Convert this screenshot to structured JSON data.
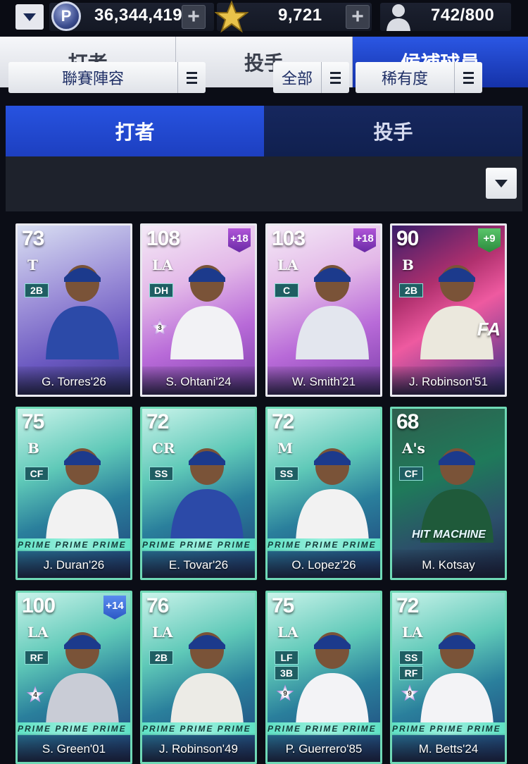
{
  "topbar": {
    "points_icon": "P",
    "points": "36,344,419",
    "stars": "9,721",
    "roster": "742/800"
  },
  "main_tabs": [
    "打者",
    "投手",
    "候補球員"
  ],
  "sub_tabs": [
    "打者",
    "投手"
  ],
  "filters": {
    "lineup": "聯賽陣容",
    "scope": "全部",
    "sort": "稀有度"
  },
  "cards": [
    {
      "ovr": "73",
      "team": "T",
      "pos": [
        "2B"
      ],
      "name": "G. Torres'26",
      "style": "wbc",
      "player_color": "#2c4aa8"
    },
    {
      "ovr": "108",
      "team": "LA",
      "pos": [
        "DH"
      ],
      "name": "S. Ohtani'24",
      "style": "signature",
      "bonus": "+18",
      "badge": "3",
      "player_color": "#f2f2f5"
    },
    {
      "ovr": "103",
      "team": "LA",
      "pos": [
        "C"
      ],
      "name": "W. Smith'21",
      "style": "signature",
      "bonus": "+18",
      "player_color": "#e3e6ee"
    },
    {
      "ovr": "90",
      "team": "B",
      "pos": [
        "2B"
      ],
      "name": "J. Robinson'51",
      "style": "fa",
      "bonus": "+9",
      "overlay": "FA",
      "player_color": "#ebe8dd"
    },
    {
      "ovr": "75",
      "team": "B",
      "pos": [
        "CF"
      ],
      "name": "J. Duran'26",
      "style": "prime",
      "player_color": "#f2f2f2"
    },
    {
      "ovr": "72",
      "team": "CR",
      "pos": [
        "SS"
      ],
      "name": "E. Tovar'26",
      "style": "prime",
      "player_color": "#2c4aa8"
    },
    {
      "ovr": "72",
      "team": "M",
      "pos": [
        "SS"
      ],
      "name": "O. Lopez'26",
      "style": "prime",
      "player_color": "#f2f2f2"
    },
    {
      "ovr": "68",
      "team": "A's",
      "pos": [
        "CF"
      ],
      "name": "M. Kotsay",
      "style": "hitmachine",
      "overlay": "HIT MACHINE",
      "player_color": "#1f5a3a"
    },
    {
      "ovr": "100",
      "team": "LA",
      "pos": [
        "RF"
      ],
      "name": "S. Green'01",
      "style": "prime",
      "bonus": "+14",
      "badge": "4",
      "player_color": "#c9ccd6"
    },
    {
      "ovr": "76",
      "team": "LA",
      "pos": [
        "2B"
      ],
      "name": "J. Robinson'49",
      "style": "prime",
      "player_color": "#ecebe6"
    },
    {
      "ovr": "75",
      "team": "LA",
      "pos": [
        "LF",
        "3B"
      ],
      "name": "P. Guerrero'85",
      "style": "prime",
      "badge": "9",
      "player_color": "#f3f3f6"
    },
    {
      "ovr": "72",
      "team": "LA",
      "pos": [
        "SS",
        "RF"
      ],
      "name": "M. Betts'24",
      "style": "prime",
      "badge": "9",
      "player_color": "#f3f3f6"
    }
  ],
  "prime_strip_text": "PRIME   PRIME   PRIME",
  "colors": {
    "accent_blue": "#2753e0",
    "prime_teal": "#6fd9b6",
    "signature_purple": "#b86ad8"
  }
}
